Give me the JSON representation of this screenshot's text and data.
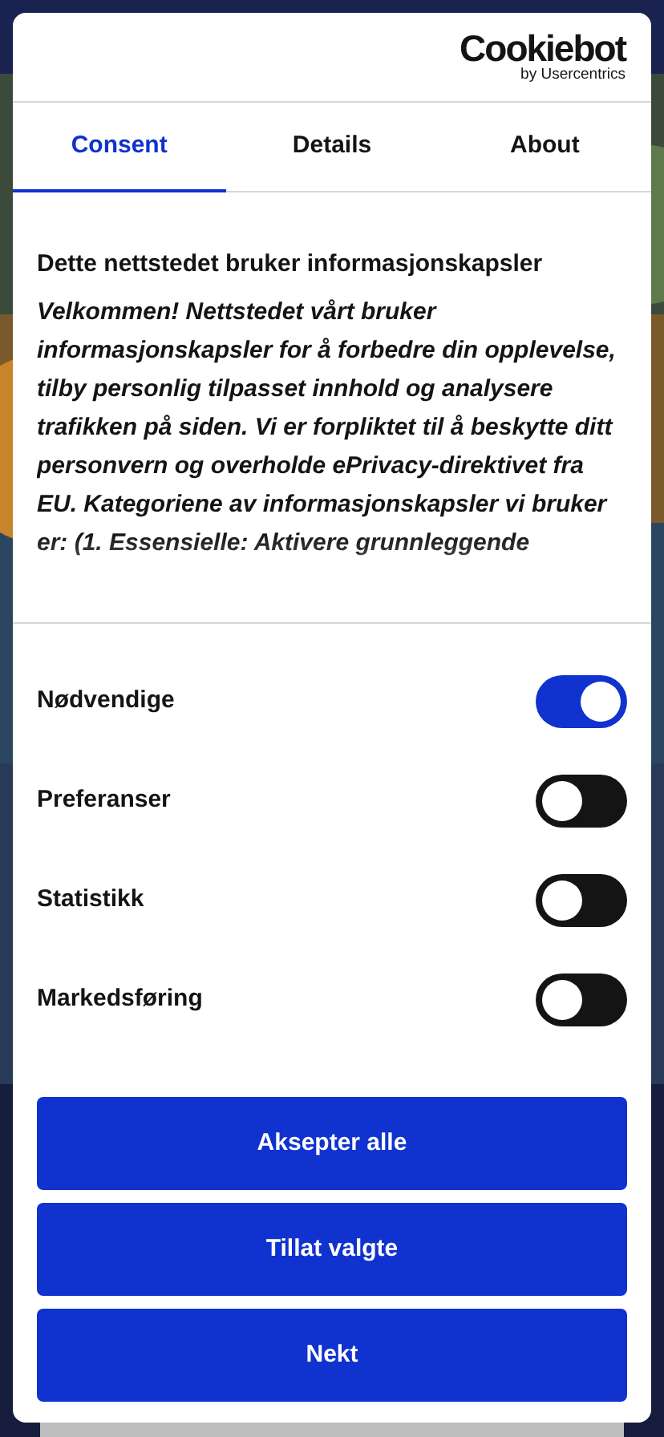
{
  "logo": {
    "name": "Cookiebot",
    "byline": "by Usercentrics"
  },
  "tabs": [
    {
      "label": "Consent",
      "selected": true
    },
    {
      "label": "Details",
      "selected": false
    },
    {
      "label": "About",
      "selected": false
    }
  ],
  "intro": {
    "title": "Dette nettstedet bruker informasjonskapsler",
    "text": "Velkommen! Nettstedet vårt bruker informasjonskapsler for å forbedre din opplevelse, tilby personlig tilpasset innhold og analysere trafikken på siden. Vi er forpliktet til å beskytte ditt personvern og overholde ePrivacy-direktivet fra EU. Kategoriene av informasjonskapsler vi bruker er: (1. Essensielle: Aktivere grunnleggende"
  },
  "categories": [
    {
      "label": "Nødvendige",
      "on": true
    },
    {
      "label": "Preferanser",
      "on": false
    },
    {
      "label": "Statistikk",
      "on": false
    },
    {
      "label": "Markedsføring",
      "on": false
    }
  ],
  "buttons": [
    "Aksepter alle",
    "Tillat valgte",
    "Nekt"
  ]
}
